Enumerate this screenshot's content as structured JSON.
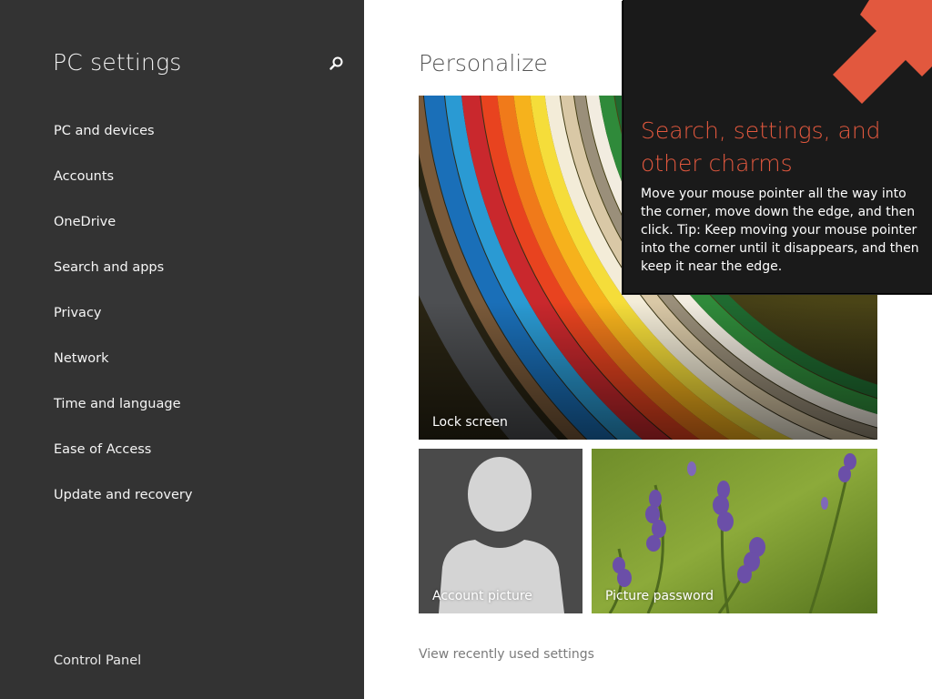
{
  "sidebar": {
    "title": "PC settings",
    "search_icon": "search-icon",
    "items": [
      {
        "label": "PC and devices"
      },
      {
        "label": "Accounts"
      },
      {
        "label": "OneDrive"
      },
      {
        "label": "Search and apps"
      },
      {
        "label": "Privacy"
      },
      {
        "label": "Network"
      },
      {
        "label": "Time and language"
      },
      {
        "label": "Ease of Access"
      },
      {
        "label": "Update and recovery"
      }
    ],
    "footer_link": "Control Panel"
  },
  "main": {
    "title": "Personalize",
    "tiles": {
      "lock_screen": "Lock screen",
      "account_picture": "Account picture",
      "picture_password": "Picture password"
    },
    "recent_link": "View recently used settings"
  },
  "tip": {
    "title": "Search, settings, and other charms",
    "body": "Move your mouse pointer all the way into the corner, move down the edge, and then click. Tip: Keep moving your mouse pointer into the corner until it disappears, and then keep it near the edge.",
    "arrow_icon": "arrow-up-right-icon"
  },
  "colors": {
    "sidebar_bg": "#333333",
    "accent": "#e2583e",
    "tip_bg": "#1a1a1a"
  }
}
